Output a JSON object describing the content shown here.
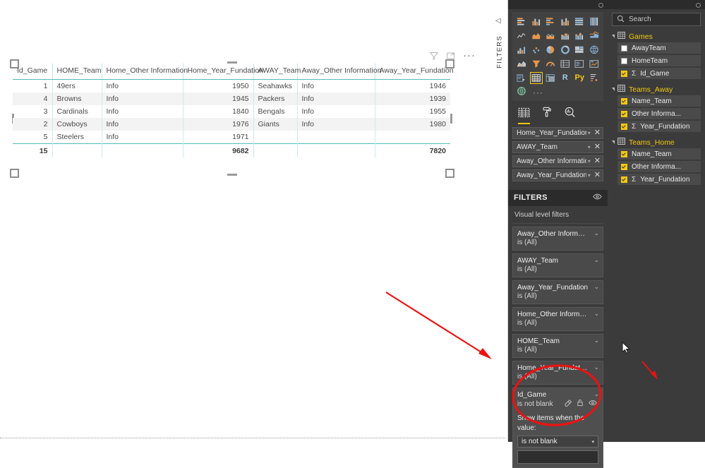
{
  "visual": {
    "toolbar": {
      "filter_icon": "filter-icon",
      "focus_icon": "focus-mode-icon",
      "more_label": "···"
    },
    "table": {
      "columns": [
        "Id_Game",
        "HOME_Team",
        "Home_Other Information",
        "Home_Year_Fundation",
        "AWAY_Team",
        "Away_Other Information",
        "Away_Year_Fundation"
      ],
      "rows": [
        [
          "1",
          "49ers",
          "Info",
          "1950",
          "Seahawks",
          "Info",
          "1946"
        ],
        [
          "4",
          "Browns",
          "Info",
          "1945",
          "Packers",
          "Info",
          "1939"
        ],
        [
          "3",
          "Cardinals",
          "Info",
          "1840",
          "Bengals",
          "Info",
          "1955"
        ],
        [
          "2",
          "Cowboys",
          "Info",
          "1976",
          "Giants",
          "Info",
          "1980"
        ],
        [
          "5",
          "Steelers",
          "Info",
          "1971",
          "",
          "",
          ""
        ]
      ],
      "total_row": [
        "15",
        "",
        "",
        "9682",
        "",
        "",
        "7820"
      ]
    }
  },
  "filters_tab": {
    "label": "FILTERS",
    "arrow": "◁"
  },
  "visualizations": {
    "gallery_icons": [
      "stacked-bar-chart-icon",
      "stacked-column-chart-icon",
      "clustered-bar-chart-icon",
      "clustered-column-chart-icon",
      "100-stacked-bar-chart-icon",
      "100-stacked-column-chart-icon",
      "line-chart-icon",
      "area-chart-icon",
      "stacked-area-chart-icon",
      "line-stacked-column-chart-icon",
      "line-clustered-column-chart-icon",
      "ribbon-chart-icon",
      "waterfall-chart-icon",
      "scatter-chart-icon",
      "pie-chart-icon",
      "donut-chart-icon",
      "treemap-icon",
      "map-icon",
      "filled-map-icon",
      "funnel-icon",
      "gauge-icon",
      "multi-row-card-icon",
      "card-icon",
      "kpi-icon",
      "slicer-icon",
      "table-icon",
      "matrix-icon",
      "r-script-visual-icon",
      "python-visual-icon",
      "key-influencers-icon",
      "arcgis-map-icon"
    ],
    "selected_icon": "table-icon",
    "more_visuals_label": "···",
    "tabs": [
      {
        "name": "fields-tab",
        "icon": "fields-table-icon",
        "selected": true
      },
      {
        "name": "format-tab",
        "icon": "paint-roller-icon",
        "selected": false
      },
      {
        "name": "analytics-tab",
        "icon": "magnifier-chart-icon",
        "selected": false
      }
    ],
    "wells": [
      {
        "name": "Home_Year_Fundation"
      },
      {
        "name": "AWAY_Team"
      },
      {
        "name": "Away_Other Informatior"
      },
      {
        "name": "Away_Year_Fundation"
      }
    ],
    "well_caret": "▾",
    "well_remove": "✕"
  },
  "filters": {
    "title": "FILTERS",
    "eye_icon": "hide-filters-icon",
    "section_label": "Visual level filters",
    "cards": [
      {
        "name": "Away_Other Informati...",
        "status": "is (All)"
      },
      {
        "name": "AWAY_Team",
        "status": "is (All)"
      },
      {
        "name": "Away_Year_Fundation",
        "status": "is (All)"
      },
      {
        "name": "Home_Other Informat...",
        "status": "is (All)"
      },
      {
        "name": "HOME_Team",
        "status": "is (All)"
      },
      {
        "name": "Home_Year_Fundation",
        "status": "is (All)"
      }
    ],
    "expanded_card": {
      "name": "Id_Game",
      "status": "is not blank",
      "clear_icon": "eraser-icon",
      "lock_icon": "lock-icon",
      "eye_icon": "eye-icon",
      "chevron": "⌄",
      "filter_type_label": "Show items when the value:",
      "condition_value": "is not blank",
      "condition_caret": "▾",
      "value_input": ""
    }
  },
  "fields": {
    "search": {
      "placeholder": "Search",
      "icon": "search-icon"
    },
    "tables": [
      {
        "name": "Games",
        "icon": "table-grid-icon",
        "items": [
          {
            "label": "AwayTeam",
            "checked": false,
            "aggregate": ""
          },
          {
            "label": "HomeTeam",
            "checked": false,
            "aggregate": ""
          },
          {
            "label": "Id_Game",
            "checked": true,
            "aggregate": "Σ"
          }
        ]
      },
      {
        "name": "Teams_Away",
        "icon": "table-grid-icon",
        "items": [
          {
            "label": "Name_Team",
            "checked": true,
            "aggregate": ""
          },
          {
            "label": "Other Informa...",
            "checked": true,
            "aggregate": ""
          },
          {
            "label": "Year_Fundation",
            "checked": true,
            "aggregate": "Σ"
          }
        ]
      },
      {
        "name": "Teams_Home",
        "icon": "table-grid-icon",
        "items": [
          {
            "label": "Name_Team",
            "checked": true,
            "aggregate": ""
          },
          {
            "label": "Other Informa...",
            "checked": true,
            "aggregate": ""
          },
          {
            "label": "Year_Fundation",
            "checked": true,
            "aggregate": "Σ"
          }
        ]
      }
    ]
  },
  "annotations": {
    "color": "#ee1111",
    "arrow_large": "arrow-pointing-to-id-game-filter",
    "arrow_small": "arrow-annotation",
    "ellipse": "ellipse-highlight-id-game-filter"
  },
  "cursor": {
    "icon": "mouse-pointer-icon"
  },
  "colors": {
    "accent_yellow": "#f2c811",
    "table_teal": "#4fbdbd",
    "panel_bg": "#3b3b3b",
    "annotation_red": "#ee1111"
  }
}
